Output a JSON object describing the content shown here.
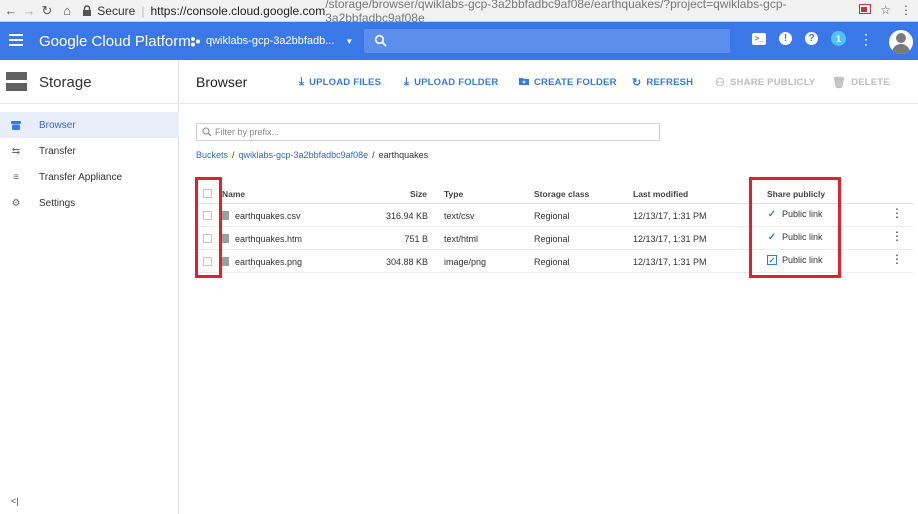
{
  "browser": {
    "secure_label": "Secure",
    "url_host": "https://console.cloud.google.com",
    "url_path": "/storage/browser/qwiklabs-gcp-3a2bbfadbc9af08e/earthquakes/?project=qwiklabs-gcp-3a2bbfadbc9af08e"
  },
  "header": {
    "brand": "Google Cloud Platform",
    "project": "qwiklabs-gcp-3a2bbfadb...",
    "notification_count": "1",
    "accent": "#3b78e7"
  },
  "sidebar": {
    "title": "Storage",
    "items": [
      {
        "label": "Browser",
        "icon": "bucket-icon",
        "active": true
      },
      {
        "label": "Transfer",
        "icon": "transfer-icon"
      },
      {
        "label": "Transfer Appliance",
        "icon": "list-icon"
      },
      {
        "label": "Settings",
        "icon": "gear-icon"
      }
    ],
    "collapse_label": "<|"
  },
  "toolbar": {
    "title": "Browser",
    "upload_files": "UPLOAD FILES",
    "upload_folder": "UPLOAD FOLDER",
    "create_folder": "CREATE FOLDER",
    "refresh": "REFRESH",
    "share_publicly": "SHARE PUBLICLY",
    "delete": "DELETE"
  },
  "filter": {
    "placeholder": "Filter by prefix..."
  },
  "breadcrumb": {
    "buckets": "Buckets",
    "bucket": "qwiklabs-gcp-3a2bbfadbc9af08e",
    "folder": "earthquakes",
    "separator": "/"
  },
  "table": {
    "columns": {
      "name": "Name",
      "size": "Size",
      "type": "Type",
      "storage_class": "Storage class",
      "last_modified": "Last modified",
      "share_publicly": "Share publicly"
    },
    "rows": [
      {
        "name": "earthquakes.csv",
        "size": "316.94 KB",
        "type": "text/csv",
        "storage_class": "Regional",
        "last_modified": "12/13/17, 1:31 PM",
        "share": "Public link"
      },
      {
        "name": "earthquakes.htm",
        "size": "751 B",
        "type": "text/html",
        "storage_class": "Regional",
        "last_modified": "12/13/17, 1:31 PM",
        "share": "Public link"
      },
      {
        "name": "earthquakes.png",
        "size": "304.88 KB",
        "type": "image/png",
        "storage_class": "Regional",
        "last_modified": "12/13/17, 1:31 PM",
        "share": "Public link"
      }
    ]
  },
  "highlight_color": "#e0202a"
}
